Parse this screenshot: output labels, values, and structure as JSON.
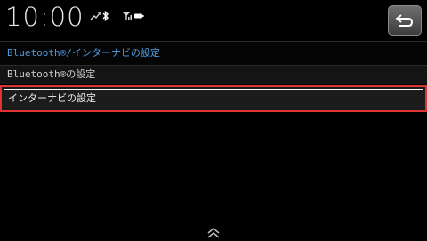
{
  "status_bar": {
    "time": "10:00",
    "icons": [
      "phone-signal-icon",
      "bluetooth-icon",
      "cellular-signal-icon",
      "battery-icon"
    ]
  },
  "header": {
    "back_button_icon": "return-arrow-icon"
  },
  "breadcrumb": {
    "text": "Bluetooth®/インターナビの設定"
  },
  "menu": {
    "items": [
      {
        "label": "Bluetooth®の設定",
        "selected": false
      },
      {
        "label": "インターナビの設定",
        "selected": true
      }
    ]
  },
  "footer": {
    "scroll_icon": "double-chevron-up-icon"
  },
  "colors": {
    "background": "#000000",
    "breadcrumb_text": "#4f9be0",
    "selection_highlight": "#e03434",
    "text": "#d0d0d0"
  }
}
